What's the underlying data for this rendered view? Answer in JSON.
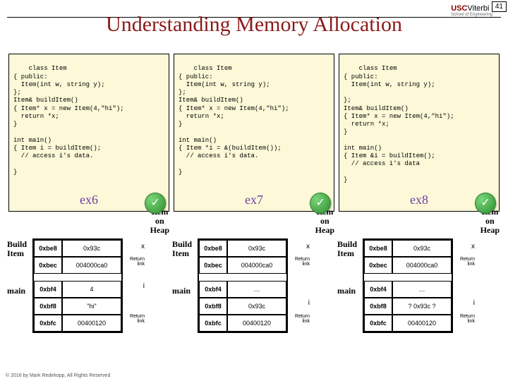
{
  "page_number": "41",
  "logo": {
    "usc": "USC",
    "viterbi": "Viterbi",
    "school": "School of Engineering"
  },
  "title": "Understanding Memory Allocation",
  "code": {
    "c1": "class Item\n{ public:\n  Item(int w, string y);\n};\nItem& buildItem()\n{ Item* x = new Item(4,\"hi\");\n  return *x;\n}\n\nint main()\n{ Item i = buildItem();\n  // access i's data.\n\n}",
    "c2": "class Item\n{ public:\n  Item(int w, string y);\n};\nItem& buildItem()\n{ Item* x = new Item(4,\"hi\");\n  return *x;\n}\n\nint main()\n{ Item *i = &(buildItem());\n  // access i's data.\n\n}",
    "c3": "class Item\n{ public:\n  Item(int w, string y);\n\n};\nItem& buildItem()\n{ Item* x = new Item(4,\"hi\");\n  return *x;\n}\n\nint main()\n{ Item &i = buildItem();\n  // access i's data\n\n}"
  },
  "exlabels": {
    "e1": "ex6",
    "e2": "ex7",
    "e3": "ex8"
  },
  "labels": {
    "build_item": "Build\nItem",
    "main": "main",
    "item_on_heap": "Item\non\nHeap",
    "return_link": "Return\nlink"
  },
  "stacks": {
    "d1": {
      "r0": {
        "addr": "0xbe8",
        "val": "0x93c",
        "var": "x"
      },
      "r1": {
        "addr": "0xbec",
        "val": "004000ca0",
        "var": "Return\nlink"
      },
      "r2": {
        "addr": "0xbf4",
        "val": "4",
        "var": "i"
      },
      "r3": {
        "addr": "0xbf8",
        "val": "\"hi\"",
        "var": ""
      },
      "r4": {
        "addr": "0xbfc",
        "val": "00400120",
        "var": "Return\nlink"
      }
    },
    "d2": {
      "r0": {
        "addr": "0xbe8",
        "val": "0x93c",
        "var": "x"
      },
      "r1": {
        "addr": "0xbec",
        "val": "004000ca0",
        "var": "Return\nlink"
      },
      "r2": {
        "addr": "0xbf4",
        "val": "…",
        "var": ""
      },
      "r3": {
        "addr": "0xbf8",
        "val": "0x93c",
        "var": "i"
      },
      "r4": {
        "addr": "0xbfc",
        "val": "00400120",
        "var": "Return\nlink"
      }
    },
    "d3": {
      "r0": {
        "addr": "0xbe8",
        "val": "0x93c",
        "var": "x"
      },
      "r1": {
        "addr": "0xbec",
        "val": "004000ca0",
        "var": "Return\nlink"
      },
      "r2": {
        "addr": "0xbf4",
        "val": "…",
        "var": ""
      },
      "r3": {
        "addr": "0xbf8",
        "val": "? 0x93c ?",
        "var": "i"
      },
      "r4": {
        "addr": "0xbfc",
        "val": "00400120",
        "var": "Return\nlink"
      }
    }
  },
  "copyright": "© 2016 by Mark Redekopp, All Rights Reserved"
}
